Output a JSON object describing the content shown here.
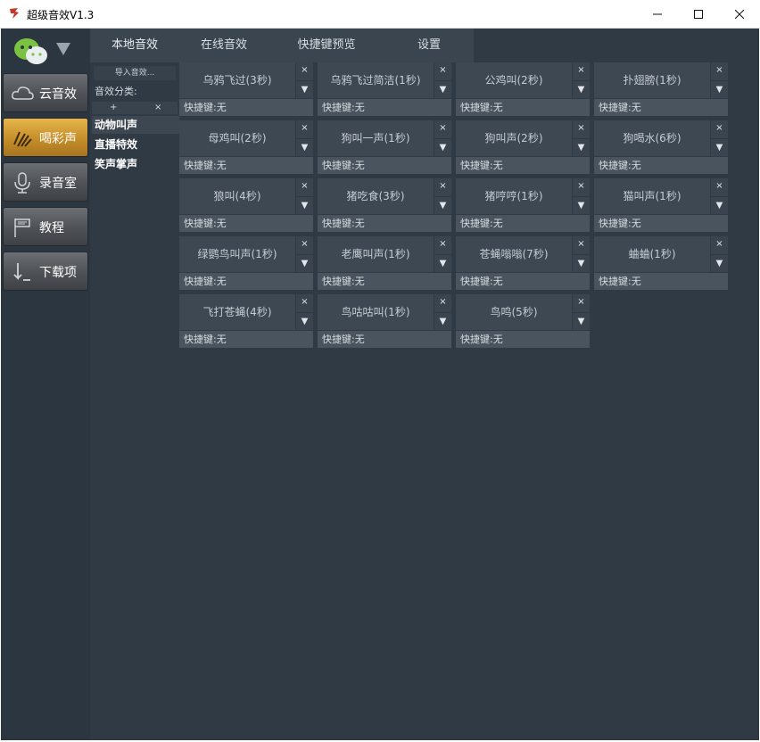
{
  "window": {
    "title": "超级音效V1.3"
  },
  "sidebar": {
    "items": [
      {
        "label": "云音效",
        "icon": "cloud-icon",
        "active": false
      },
      {
        "label": "喝彩声",
        "icon": "hands-icon",
        "active": true
      },
      {
        "label": "录音室",
        "icon": "microphone-icon",
        "active": false
      },
      {
        "label": "教程",
        "icon": "flag-icon",
        "active": false
      },
      {
        "label": "下载项",
        "icon": "download-icon",
        "active": false
      }
    ]
  },
  "tabs": [
    "本地音效",
    "在线音效",
    "快捷键预览",
    "设置"
  ],
  "categories": {
    "import_label": "导入音效...",
    "title": "音效分类:",
    "add": "+",
    "del": "×",
    "items": [
      "动物叫声",
      "直播特效",
      "笑声掌声"
    ]
  },
  "sounds": [
    {
      "name": "乌鸦飞过(3秒)",
      "hotkey": "快捷键:无"
    },
    {
      "name": "乌鸦飞过简洁(1秒)",
      "hotkey": "快捷键:无"
    },
    {
      "name": "公鸡叫(2秒)",
      "hotkey": "快捷键:无"
    },
    {
      "name": "扑翅膀(1秒)",
      "hotkey": "快捷键:无"
    },
    {
      "name": "母鸡叫(2秒)",
      "hotkey": "快捷键:无"
    },
    {
      "name": "狗叫一声(1秒)",
      "hotkey": "快捷键:无"
    },
    {
      "name": "狗叫声(2秒)",
      "hotkey": "快捷键:无"
    },
    {
      "name": "狗喝水(6秒)",
      "hotkey": "快捷键:无"
    },
    {
      "name": "狼叫(4秒)",
      "hotkey": "快捷键:无"
    },
    {
      "name": "猪吃食(3秒)",
      "hotkey": "快捷键:无"
    },
    {
      "name": "猪哼哼(1秒)",
      "hotkey": "快捷键:无"
    },
    {
      "name": "猫叫声(1秒)",
      "hotkey": "快捷键:无"
    },
    {
      "name": "绿鹦鸟叫声(1秒)",
      "hotkey": "快捷键:无"
    },
    {
      "name": "老鹰叫声(1秒)",
      "hotkey": "快捷键:无"
    },
    {
      "name": "苍蝇嗡嗡(7秒)",
      "hotkey": "快捷键:无"
    },
    {
      "name": "蛐蛐(1秒)",
      "hotkey": "快捷键:无"
    },
    {
      "name": "飞打苍蝇(4秒)",
      "hotkey": "快捷键:无"
    },
    {
      "name": "鸟咕咕叫(1秒)",
      "hotkey": "快捷键:无"
    },
    {
      "name": "鸟鸣(5秒)",
      "hotkey": "快捷键:无"
    }
  ],
  "card_controls": {
    "close": "×",
    "dropdown": "▼"
  },
  "colors": {
    "active_nav": "#e0a83f",
    "background": "#2f3a44"
  }
}
